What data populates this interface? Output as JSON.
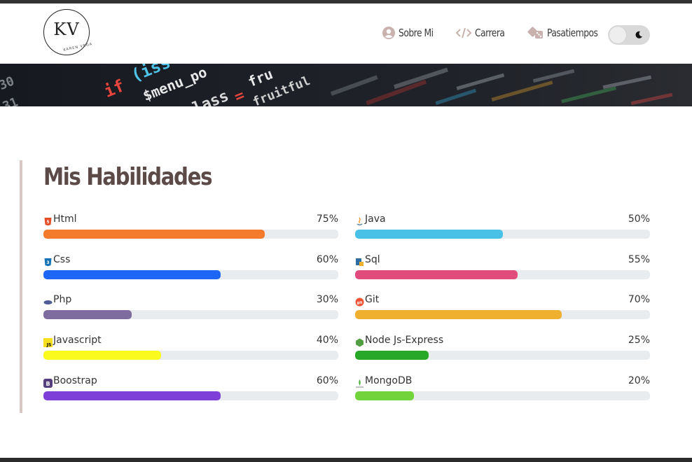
{
  "logo": {
    "initials": "KV",
    "subtitle": "KAREN VEGA"
  },
  "nav": [
    {
      "label": "Sobre Mi",
      "icon": "user-circle-icon"
    },
    {
      "label": "Carrera",
      "icon": "code-icon"
    },
    {
      "label": "Pasatiempos",
      "icon": "dice-icon"
    }
  ],
  "theme_toggle": {
    "icon": "moon-icon",
    "state": "light"
  },
  "skills": {
    "title": "Mis Habilidades",
    "left": [
      {
        "name": "Html",
        "percent": "75%",
        "value": 75,
        "color": "#f47b2c",
        "icon": "html5-icon"
      },
      {
        "name": "Css",
        "percent": "60%",
        "value": 60,
        "color": "#1e66f5",
        "icon": "css3-icon"
      },
      {
        "name": "Php",
        "percent": "30%",
        "value": 30,
        "color": "#7d6c9d",
        "icon": "php-icon"
      },
      {
        "name": "Javascript",
        "percent": "40%",
        "value": 40,
        "color": "#fafa1e",
        "icon": "javascript-icon"
      },
      {
        "name": "Boostrap",
        "percent": "60%",
        "value": 60,
        "color": "#7e3fd9",
        "icon": "bootstrap-icon"
      }
    ],
    "right": [
      {
        "name": "Java",
        "percent": "50%",
        "value": 50,
        "color": "#49c0e6",
        "icon": "java-icon"
      },
      {
        "name": "Sql",
        "percent": "55%",
        "value": 55,
        "color": "#e24c7d",
        "icon": "sql-icon"
      },
      {
        "name": "Git",
        "percent": "70%",
        "value": 70,
        "color": "#f0b02f",
        "icon": "git-icon"
      },
      {
        "name": "Node Js-Express",
        "percent": "25%",
        "value": 25,
        "color": "#28a828",
        "icon": "nodejs-icon"
      },
      {
        "name": "MongoDB",
        "percent": "20%",
        "value": 20,
        "color": "#72d43a",
        "icon": "mongodb-icon"
      }
    ]
  }
}
